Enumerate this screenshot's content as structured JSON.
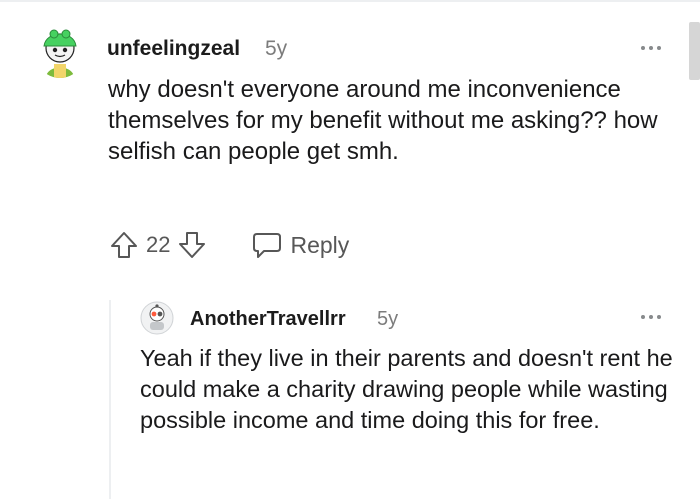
{
  "comments": [
    {
      "username": "unfeelingzeal",
      "age": "5y",
      "body": "why doesn't everyone around me inconvenience themselves for my benefit without me asking?? how selfish can people get smh.",
      "score": "22",
      "reply_label": "Reply"
    },
    {
      "username": "AnotherTravellrr",
      "age": "5y",
      "body": "Yeah if they live in their parents and doesn't rent he could make a charity drawing people while wasting possible income and time doing this for free."
    }
  ],
  "colors": {
    "text": "#1a1a1b",
    "meta": "#7c7c7c",
    "icon": "#575757",
    "avatar_green": "#46d160"
  },
  "icons": [
    "avatar-icon",
    "more-options-icon",
    "upvote-icon",
    "downvote-icon",
    "reply-bubble-icon"
  ]
}
